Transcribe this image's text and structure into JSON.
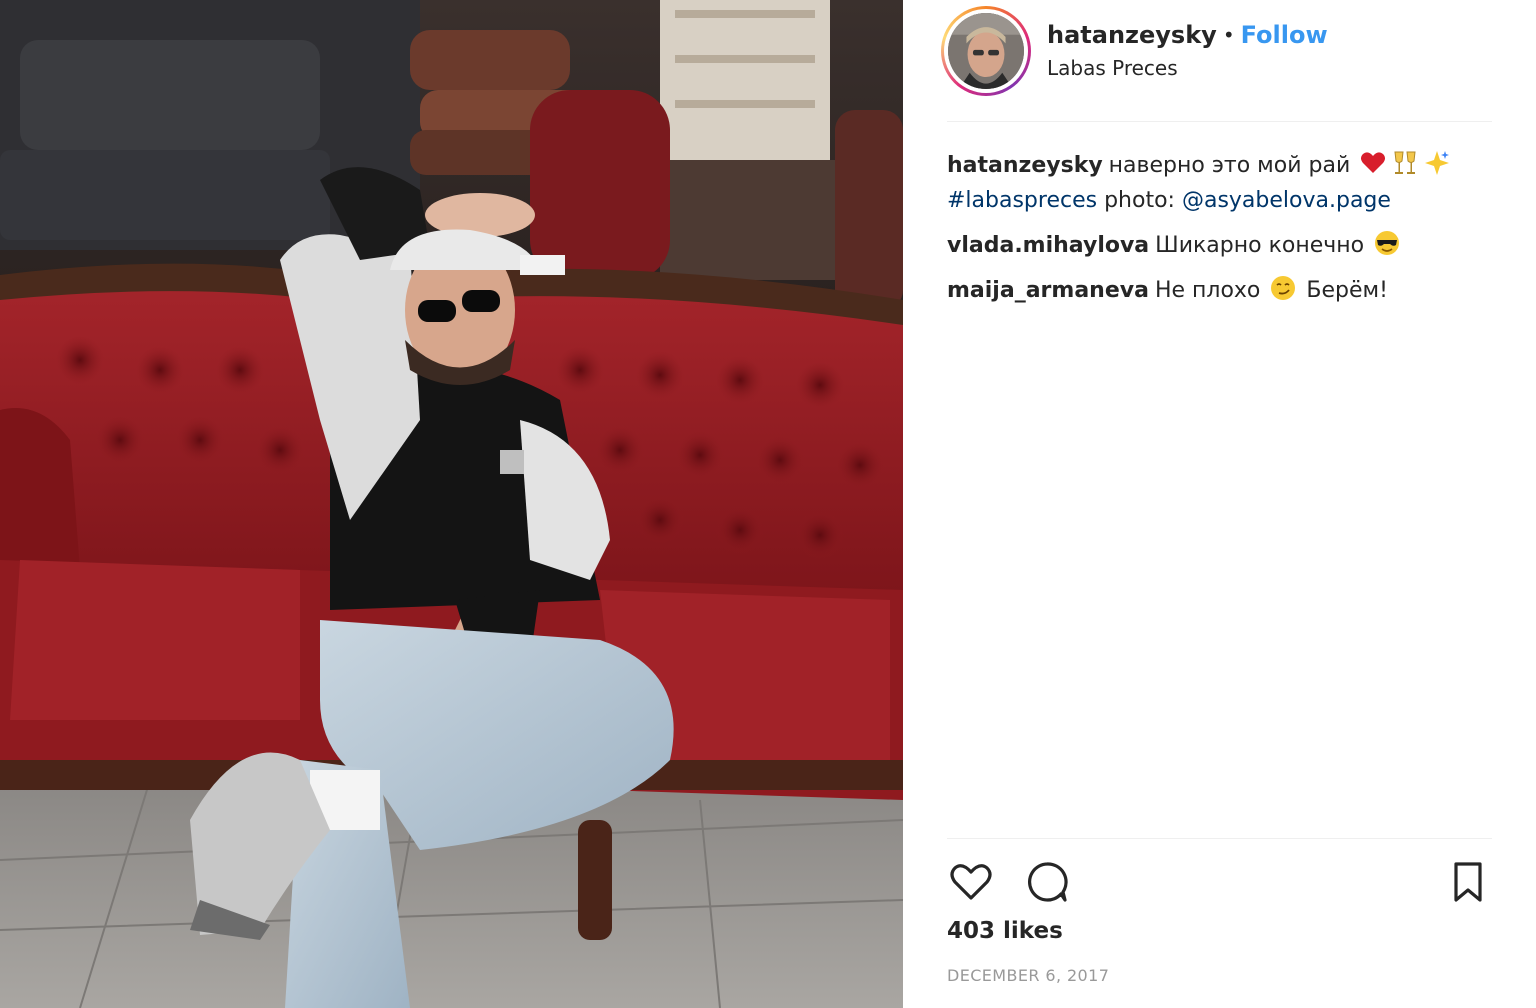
{
  "post": {
    "photo_alt": "",
    "header": {
      "username": "hatanzeysky",
      "separator": "•",
      "follow_label": "Follow",
      "location": "Labas Preces"
    },
    "caption": {
      "username": "hatanzeysky",
      "text": "наверно это мой рай",
      "emojis": [
        "heart-emoji",
        "clinking-glasses-emoji",
        "sparkles-emoji"
      ],
      "hashtag": "#labaspreces",
      "photo_label": "photo:",
      "mention": "@asyabelova.page"
    },
    "comments": [
      {
        "username": "vlada.mihaylova",
        "text": "Шикарно конечно",
        "emoji": "sunglasses-face-emoji"
      },
      {
        "username": "maija_armaneva",
        "text_before": "Не плохо",
        "emoji": "smirking-face-emoji",
        "text_after": "Берём!"
      }
    ],
    "actions": {
      "like_icon": "heart-outline-icon",
      "comment_icon": "speech-bubble-icon",
      "save_icon": "bookmark-icon"
    },
    "likes": "403 likes",
    "date": "DECEMBER 6, 2017"
  },
  "colors": {
    "follow": "#3897f0",
    "link": "#003569",
    "sofa": "#8e1b1f",
    "date": "#999999"
  }
}
